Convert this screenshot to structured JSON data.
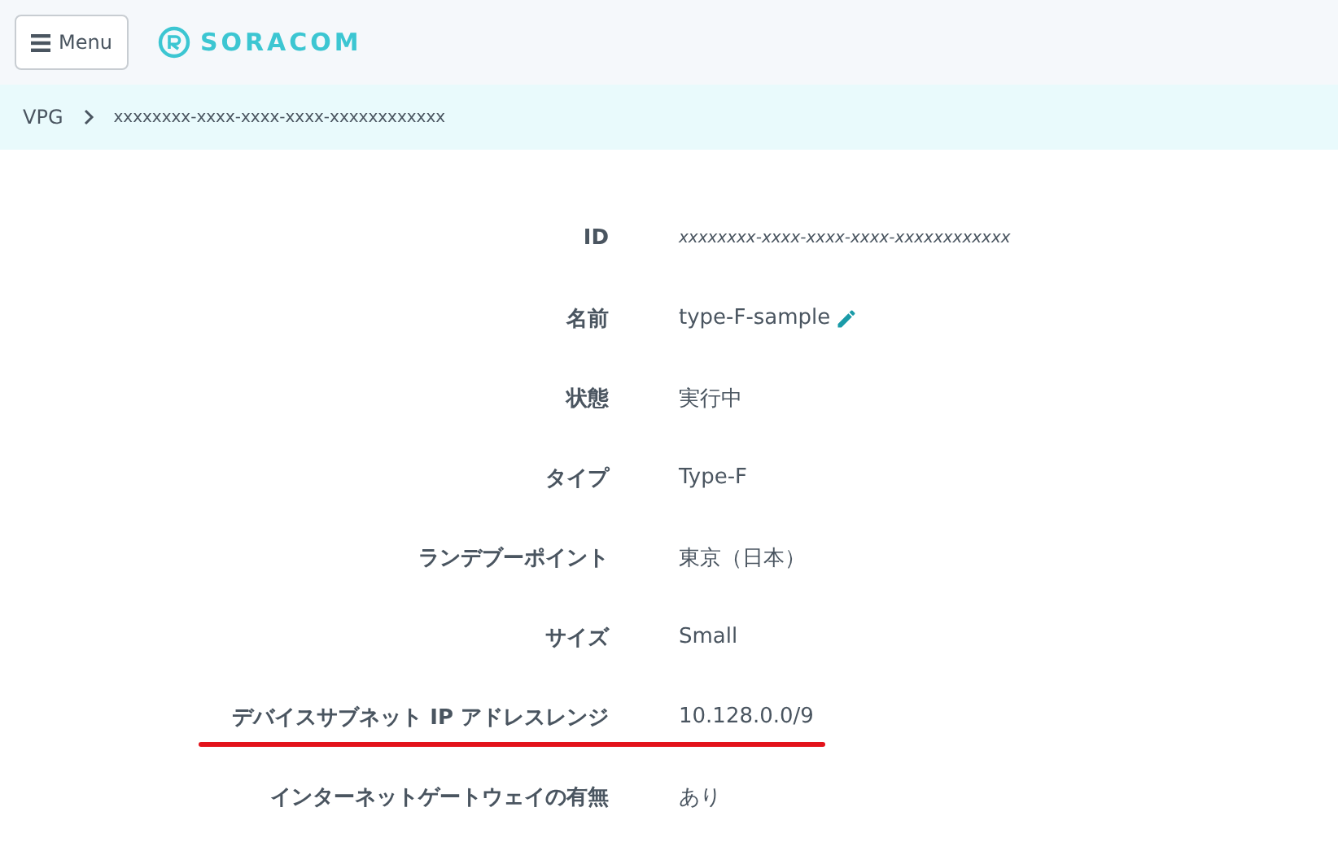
{
  "header": {
    "menu_button": "Menu",
    "logo": "SORACOM"
  },
  "breadcrumb": [
    "VPG",
    "xxxxxxxx-xxxx-xxxx-xxxx-xxxxxxxxxxxx"
  ],
  "details": [
    {
      "label": "ID",
      "value": "xxxxxxxx-xxxx-xxxx-xxxx-xxxxxxxxxxxx",
      "kind": "id",
      "highlighted": false
    },
    {
      "label": "名前",
      "value": "type-F-sample",
      "kind": "editable",
      "highlighted": false
    },
    {
      "label": "状態",
      "value": "実行中",
      "kind": "text",
      "highlighted": false
    },
    {
      "label": "タイプ",
      "value": "Type-F",
      "kind": "text",
      "highlighted": false
    },
    {
      "label": "ランデブーポイント",
      "value": "東京（日本）",
      "kind": "text",
      "highlighted": false
    },
    {
      "label": "サイズ",
      "value": "Small",
      "kind": "text",
      "highlighted": false
    },
    {
      "label": "デバイスサブネット IP アドレスレンジ",
      "value": "10.128.0.0/9",
      "kind": "text",
      "highlighted": true
    },
    {
      "label": "インターネットゲートウェイの有無",
      "value": "あり",
      "kind": "text",
      "highlighted": false
    }
  ]
}
